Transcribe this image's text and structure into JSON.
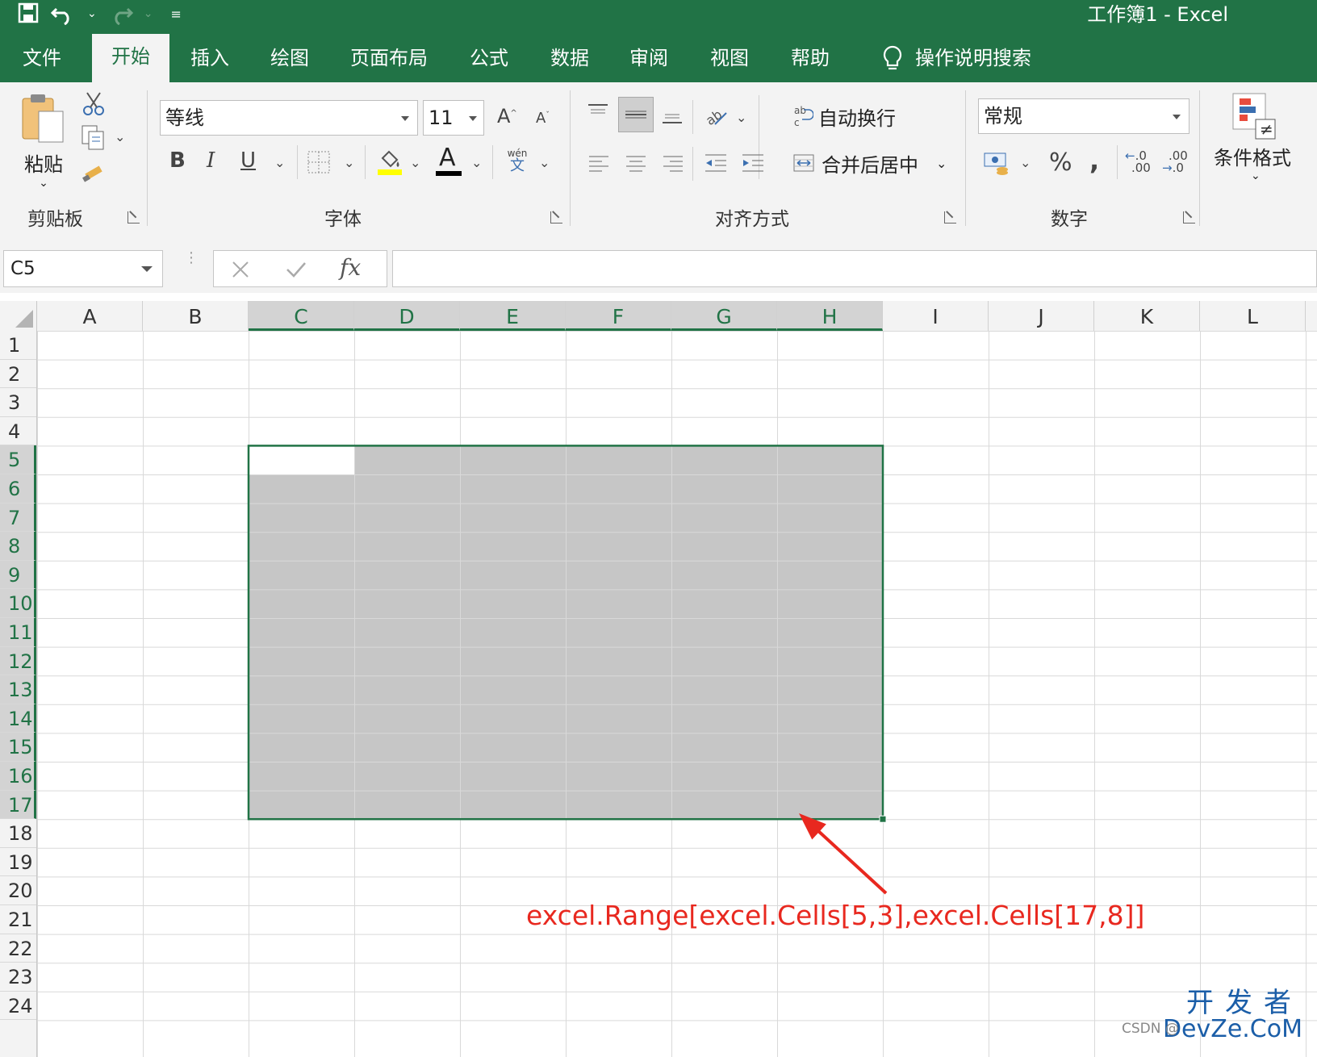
{
  "window": {
    "title": "工作簿1  -  Excel"
  },
  "tabs": [
    "文件",
    "开始",
    "插入",
    "绘图",
    "页面布局",
    "公式",
    "数据",
    "审阅",
    "视图",
    "帮助"
  ],
  "active_tab": "开始",
  "tell_me": "操作说明搜索",
  "ribbon": {
    "clipboard": {
      "paste_label": "粘贴",
      "group_label": "剪贴板"
    },
    "font": {
      "font_name": "等线",
      "font_size": "11",
      "bold": "B",
      "italic": "I",
      "underline": "U",
      "group_label": "字体",
      "phonetic_top": "wén",
      "phonetic_bottom": "文"
    },
    "alignment": {
      "wrap_text": "自动换行",
      "merge_center": "合并后居中",
      "group_label": "对齐方式"
    },
    "number": {
      "format": "常规",
      "percent": "%",
      "comma": ",",
      "inc_dec_top": ".0",
      "inc_dec_bottom": ".00",
      "dec_dec_top": ".00",
      "dec_dec_bottom": ".0",
      "group_label": "数字"
    },
    "styles": {
      "conditional_format": "条件格式"
    }
  },
  "formula_bar": {
    "name_box": "C5",
    "fx_label": "fx",
    "formula": ""
  },
  "sheet": {
    "columns": [
      "A",
      "B",
      "C",
      "D",
      "E",
      "F",
      "G",
      "H",
      "I",
      "J",
      "K",
      "L"
    ],
    "rows": [
      "1",
      "2",
      "3",
      "4",
      "5",
      "6",
      "7",
      "8",
      "9",
      "10",
      "11",
      "12",
      "13",
      "14",
      "15",
      "16",
      "17",
      "18",
      "19",
      "20",
      "21",
      "22",
      "23",
      "24"
    ],
    "selected_range": "C5:H17",
    "active_cell": "C5"
  },
  "annotation": "excel.Range[excel.Cells[5,3],excel.Cells[17,8]]",
  "watermark": {
    "line1": "开发者",
    "line2": "DevZe.CoM",
    "csdn": "CSDN @"
  },
  "colors": {
    "brand": "#217346",
    "selection": "#c6c6c6",
    "annotation": "#e8281f"
  }
}
